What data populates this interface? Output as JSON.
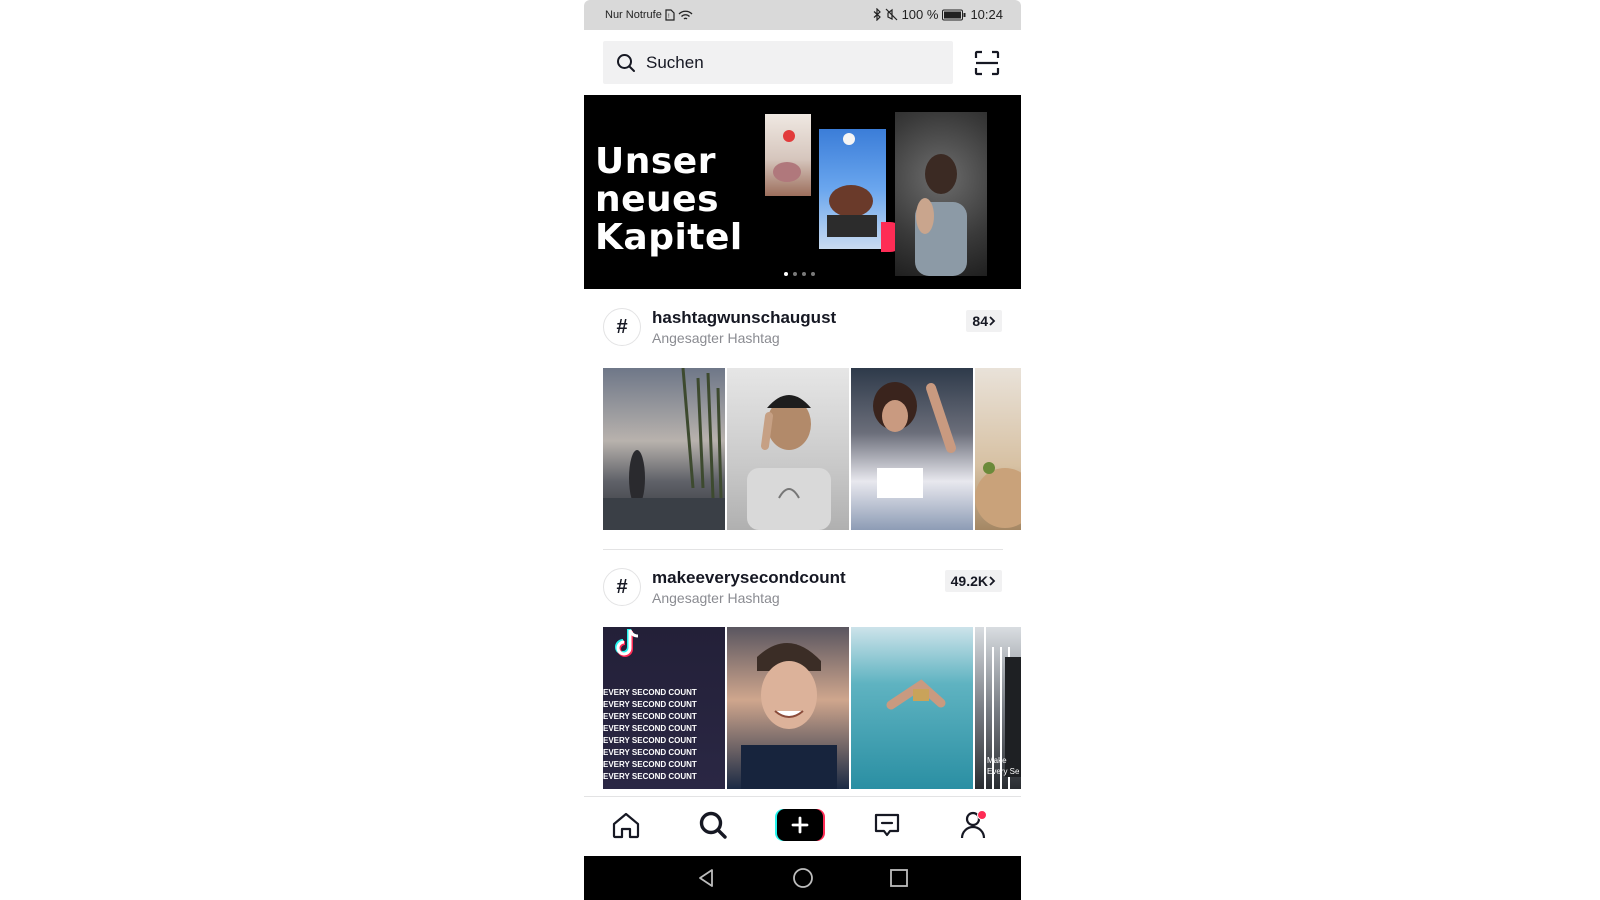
{
  "status_bar": {
    "carrier": "Nur Notrufe",
    "battery": "100 %",
    "time": "10:24"
  },
  "search": {
    "placeholder": "Suchen",
    "scan_icon": "scan-icon"
  },
  "banner": {
    "lines": [
      "Unser",
      "neues",
      "Kapitel"
    ],
    "page_count": 4,
    "active_page": 0
  },
  "hashtags": [
    {
      "name": "hashtagwunschaugust",
      "subtitle": "Angesagter Hashtag",
      "count": "84"
    },
    {
      "name": "makeeverysecondcount",
      "subtitle": "Angesagter Hashtag",
      "count": "49.2K",
      "video_text": {
        "every": "EVERY SECOND COUNT",
        "make": "Make",
        "make2": "Every Se"
      }
    }
  ],
  "tabbar": {
    "items": [
      "home-icon",
      "discover-icon",
      "create-icon",
      "inbox-icon",
      "profile-icon"
    ]
  },
  "colors": {
    "accent_pink": "#fe2c55",
    "accent_cyan": "#25f4ee",
    "text_primary": "#161823",
    "text_secondary": "#8a8b91"
  }
}
